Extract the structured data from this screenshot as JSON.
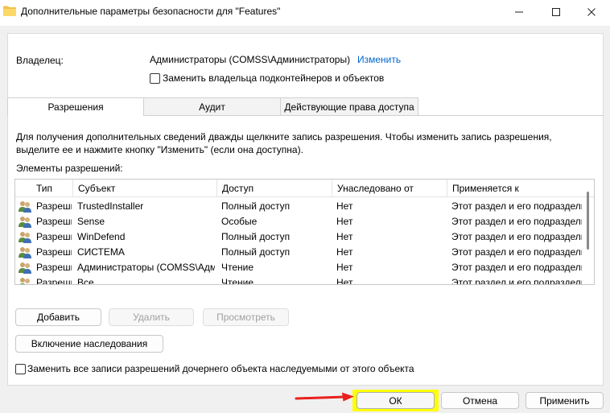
{
  "window": {
    "title": "Дополнительные параметры безопасности  для \"Features\"",
    "icons": {
      "app": "folder-icon",
      "minimize": "minimize-icon",
      "maximize": "maximize-icon",
      "close": "close-icon"
    }
  },
  "owner": {
    "label": "Владелец:",
    "value": "Администраторы (COMSS\\Администраторы)",
    "change_link": "Изменить",
    "replace_checkbox_label": "Заменить владельца подконтейнеров и объектов"
  },
  "tabs": [
    {
      "label": "Разрешения",
      "active": true
    },
    {
      "label": "Аудит",
      "active": false
    },
    {
      "label": "Действующие права доступа",
      "active": false
    }
  ],
  "description": "Для получения дополнительных сведений дважды щелкните запись разрешения. Чтобы изменить запись разрешения, выделите ее и нажмите кнопку \"Изменить\" (если она доступна).",
  "entries_label": "Элементы разрешений:",
  "table": {
    "columns": [
      "Тип",
      "Субъект",
      "Доступ",
      "Унаследовано от",
      "Применяется к"
    ],
    "rows": [
      {
        "type": "Разрешить",
        "subject": "TrustedInstaller",
        "access": "Полный доступ",
        "inherited": "Нет",
        "applies": "Этот раздел и его подразделы"
      },
      {
        "type": "Разрешить",
        "subject": "Sense",
        "access": "Особые",
        "inherited": "Нет",
        "applies": "Этот раздел и его подразделы"
      },
      {
        "type": "Разрешить",
        "subject": "WinDefend",
        "access": "Полный доступ",
        "inherited": "Нет",
        "applies": "Этот раздел и его подразделы"
      },
      {
        "type": "Разрешить",
        "subject": "СИСТЕМА",
        "access": "Полный доступ",
        "inherited": "Нет",
        "applies": "Этот раздел и его подразделы"
      },
      {
        "type": "Разрешить",
        "subject": "Администраторы (COMSS\\Администраторы)",
        "access": "Чтение",
        "inherited": "Нет",
        "applies": "Этот раздел и его подразделы"
      },
      {
        "type": "Разрешить",
        "subject": "Все",
        "access": "Чтение",
        "inherited": "Нет",
        "applies": "Этот раздел и его подразделы"
      }
    ],
    "row_icon": "user-group-icon"
  },
  "buttons": {
    "add": "Добавить",
    "remove": "Удалить",
    "view": "Просмотреть",
    "enable_inheritance": "Включение наследования",
    "ok": "ОК",
    "cancel": "Отмена",
    "apply": "Применить"
  },
  "replace_all_checkbox_label": "Заменить все записи разрешений дочернего объекта наследуемыми от этого объекта",
  "annotation": {
    "arrow_color": "#e8201e",
    "highlight_color": "#ffff00"
  }
}
